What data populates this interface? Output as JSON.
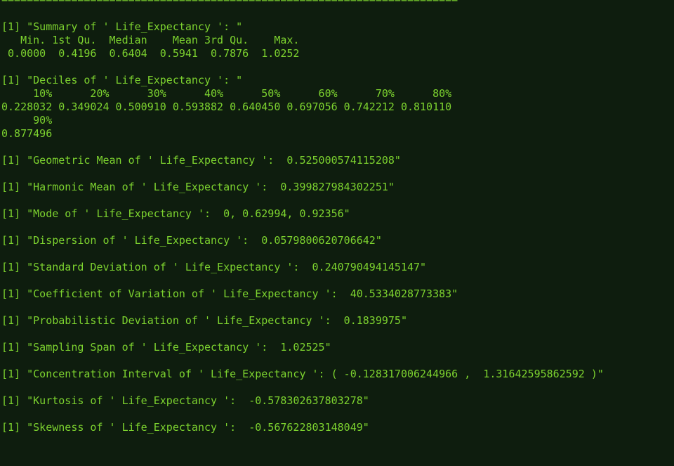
{
  "terminal": {
    "lines": [
      "========================================================================",
      "",
      "[1] \"Summary of ' Life_Expectancy ': \"",
      "   Min. 1st Qu.  Median    Mean 3rd Qu.    Max. ",
      " 0.0000  0.4196  0.6404  0.5941  0.7876  1.0252 ",
      "",
      "[1] \"Deciles of ' Life_Expectancy ': \"",
      "     10%      20%      30%      40%      50%      60%      70%      80% ",
      "0.228032 0.349024 0.500910 0.593882 0.640450 0.697056 0.742212 0.810110 ",
      "     90% ",
      "0.877496 ",
      "",
      "[1] \"Geometric Mean of ' Life_Expectancy ':  0.525000574115208\"",
      "",
      "[1] \"Harmonic Mean of ' Life_Expectancy ':  0.399827984302251\"",
      "",
      "[1] \"Mode of ' Life_Expectancy ':  0, 0.62994, 0.92356\"",
      "",
      "[1] \"Dispersion of ' Life_Expectancy ':  0.0579800620706642\"",
      "",
      "[1] \"Standard Deviation of ' Life_Expectancy ':  0.240790494145147\"",
      "",
      "[1] \"Coefficient of Variation of ' Life_Expectancy ':  40.5334028773383\"",
      "",
      "[1] \"Probabilistic Deviation of ' Life_Expectancy ':  0.1839975\"",
      "",
      "[1] \"Sampling Span of ' Life_Expectancy ':  1.02525\"",
      "",
      "[1] \"Concentration Interval of ' Life_Expectancy ': ( -0.128317006244966 ,  1.31642595862592 )\"",
      "",
      "[1] \"Kurtosis of ' Life_Expectancy ':  -0.578302637803278\"",
      "",
      "[1] \"Skewness of ' Life_Expectancy ':  -0.567622803148049\""
    ],
    "colors": {
      "background": "#0e1d0e",
      "foreground": "#7dd32f"
    }
  }
}
